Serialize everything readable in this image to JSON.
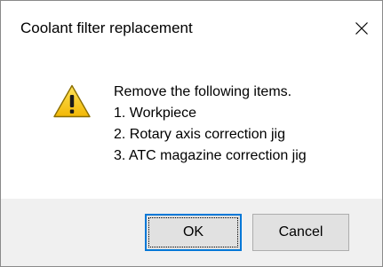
{
  "dialog": {
    "title": "Coolant filter replacement",
    "close_icon": "close-icon",
    "icon": "warning-icon",
    "message_lines": [
      "Remove the following items.",
      "1. Workpiece",
      "2. Rotary axis correction jig",
      "3. ATC magazine correction jig"
    ],
    "buttons": {
      "ok_label": "OK",
      "cancel_label": "Cancel"
    },
    "colors": {
      "footer_bg": "#f0f0f0",
      "button_bg": "#e1e1e1",
      "default_button_border": "#0078d7",
      "warning_fill": "#f8d01c"
    }
  }
}
